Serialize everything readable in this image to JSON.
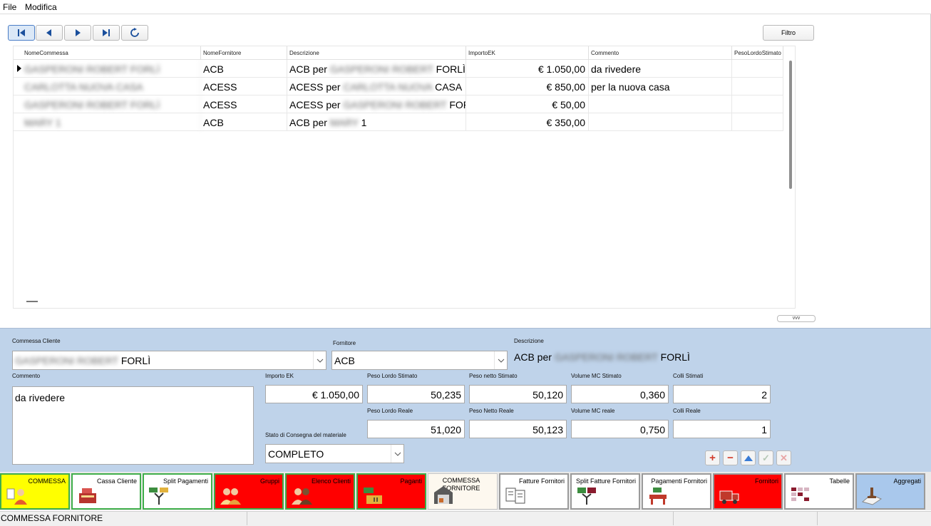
{
  "menu": {
    "file": "File",
    "edit": "Modifica"
  },
  "toolbar": {
    "filter_label": "Filtro"
  },
  "grid": {
    "columns": [
      "NomeCommessa",
      "NomeFornitore",
      "Descrizione",
      "ImportoEK",
      "Commento",
      "PesoLordoStimato"
    ],
    "rows": [
      {
        "commessa": "GASPERONI ROBERT FORLÌ",
        "fornitore": "ACB",
        "desc_pre": "ACB per",
        "desc_hidden": "GASPERONI ROBERT",
        "desc_post": "FORLÌ",
        "importo": "€ 1.050,00",
        "commento": "da rivedere"
      },
      {
        "commessa": "CARLOTTA NUOVA CASA",
        "fornitore": "ACESS",
        "desc_pre": "ACESS per",
        "desc_hidden": "CARLOTTA NUOVA",
        "desc_post": "CASA",
        "importo": "€ 850,00",
        "commento": "per la nuova casa"
      },
      {
        "commessa": "GASPERONI ROBERT FORLÌ",
        "fornitore": "ACESS",
        "desc_pre": "ACESS per",
        "desc_hidden": "GASPERONI ROBERT",
        "desc_post": "FORL",
        "importo": "€ 50,00",
        "commento": ""
      },
      {
        "commessa": "MARY 1",
        "fornitore": "ACB",
        "desc_pre": "ACB per",
        "desc_hidden": "MARY",
        "desc_post": "1",
        "importo": "€ 350,00",
        "commento": ""
      }
    ],
    "footer_label": "vvv"
  },
  "detail": {
    "commessa_label": "Commessa Cliente",
    "commessa_hidden": "GASPERONI ROBERT",
    "commessa_visible": "FORLÌ",
    "fornitore_label": "Fornitore",
    "fornitore_value": "ACB",
    "descrizione_label": "Descrizione",
    "descrizione_pre": "ACB per",
    "descrizione_hidden": "GASPERONI ROBERT",
    "descrizione_post": "FORLÌ",
    "commento_label": "Commento",
    "commento_value": "da rivedere",
    "importo_label": "Importo EK",
    "importo_value": "€ 1.050,00",
    "peso_lordo_stimato_label": "Peso Lordo Stimato",
    "peso_lordo_stimato_value": "50,235",
    "peso_netto_stimato_label": "Peso netto Stimato",
    "peso_netto_stimato_value": "50,120",
    "volume_stimato_label": "Volume MC Stimato",
    "volume_stimato_value": "0,360",
    "colli_stimati_label": "Colli Stimati",
    "colli_stimati_value": "2",
    "peso_lordo_reale_label": "Peso Lordo Reale",
    "peso_lordo_reale_value": "51,020",
    "peso_netto_reale_label": "Peso Netto Reale",
    "peso_netto_reale_value": "50,123",
    "volume_reale_label": "Volume MC reale",
    "volume_reale_value": "0,750",
    "colli_reali_label": "Colli Reale",
    "colli_reali_value": "1",
    "stato_label": "Stato di Consegna del materiale",
    "stato_value": "COMPLETO"
  },
  "tabs": [
    {
      "label": "COMMESSA",
      "bg": "#ffff00",
      "icon": "person-document-icon"
    },
    {
      "label": "Cassa Cliente",
      "bg": "#ffffff",
      "icon": "cash-register-icon"
    },
    {
      "label": "Split Pagamenti",
      "bg": "#ffffff",
      "icon": "split-payment-icon"
    },
    {
      "label": "Gruppi",
      "bg": "#ff0000",
      "icon": "group-icon"
    },
    {
      "label": "Elenco Clienti",
      "bg": "#ff0000",
      "icon": "clients-icon"
    },
    {
      "label": "Paganti",
      "bg": "#ff0000",
      "icon": "payers-icon"
    },
    {
      "label": "COMMESSA FORNITORE",
      "bg": "#fdf8ef",
      "icon": "warehouse-icon"
    },
    {
      "label": "Fatture Fornitori",
      "bg": "#ffffff",
      "icon": "invoices-icon"
    },
    {
      "label": "Split Fatture Fornitori",
      "bg": "#ffffff",
      "icon": "split-invoice-icon"
    },
    {
      "label": "Pagamenti Fornitori",
      "bg": "#ffffff",
      "icon": "supplier-payment-icon"
    },
    {
      "label": "Fornitori",
      "bg": "#ff0000",
      "icon": "truck-icon"
    },
    {
      "label": "Tabelle",
      "bg": "#ffffff",
      "icon": "table-icon"
    },
    {
      "label": "Aggregati",
      "bg": "#a9c8ec",
      "icon": "aggregate-icon"
    }
  ],
  "status": {
    "text": "COMMESSA FORNITORE"
  }
}
